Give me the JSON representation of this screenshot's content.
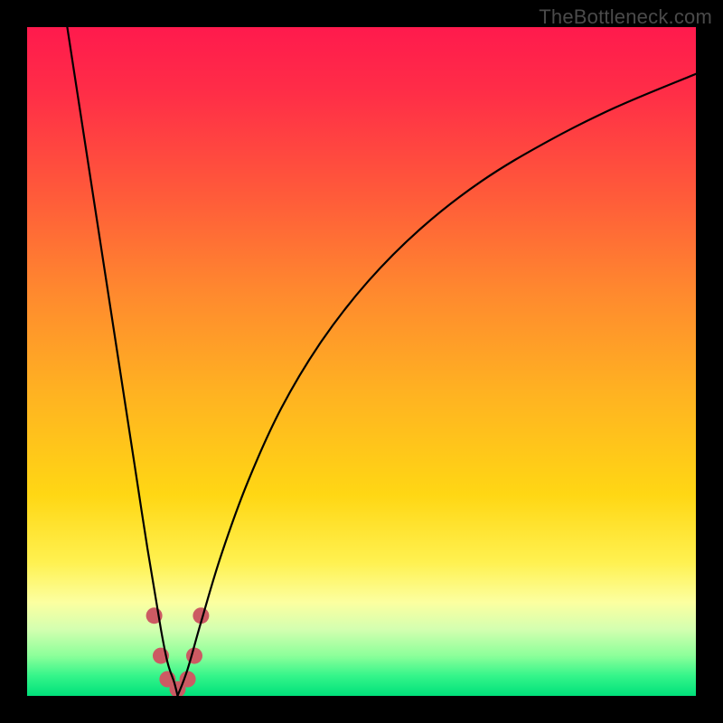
{
  "watermark": "TheBottleneck.com",
  "gradient_stops": [
    {
      "offset": 0.0,
      "color": "#ff1a4d"
    },
    {
      "offset": 0.1,
      "color": "#ff2e47"
    },
    {
      "offset": 0.25,
      "color": "#ff5a3a"
    },
    {
      "offset": 0.4,
      "color": "#ff8a2e"
    },
    {
      "offset": 0.55,
      "color": "#ffb321"
    },
    {
      "offset": 0.7,
      "color": "#ffd714"
    },
    {
      "offset": 0.8,
      "color": "#fff150"
    },
    {
      "offset": 0.86,
      "color": "#fcffa0"
    },
    {
      "offset": 0.9,
      "color": "#d4ffb0"
    },
    {
      "offset": 0.94,
      "color": "#8cff9a"
    },
    {
      "offset": 0.97,
      "color": "#35f58a"
    },
    {
      "offset": 1.0,
      "color": "#00e07a"
    }
  ],
  "markers": {
    "color": "#cc5a63",
    "radius": 9,
    "points": [
      {
        "x": 0.19,
        "y": 0.12
      },
      {
        "x": 0.2,
        "y": 0.06
      },
      {
        "x": 0.21,
        "y": 0.025
      },
      {
        "x": 0.225,
        "y": 0.01
      },
      {
        "x": 0.24,
        "y": 0.025
      },
      {
        "x": 0.25,
        "y": 0.06
      },
      {
        "x": 0.26,
        "y": 0.12
      }
    ]
  },
  "chart_data": {
    "type": "line",
    "title": "",
    "xlabel": "",
    "ylabel": "",
    "xlim": [
      0,
      1
    ],
    "ylim": [
      0,
      1
    ],
    "grid": false,
    "legend": false,
    "series": [
      {
        "name": "curve-left",
        "x": [
          0.06,
          0.08,
          0.1,
          0.12,
          0.14,
          0.16,
          0.18,
          0.2,
          0.21,
          0.22,
          0.225
        ],
        "values": [
          1.0,
          0.87,
          0.74,
          0.61,
          0.48,
          0.35,
          0.22,
          0.1,
          0.05,
          0.02,
          0.0
        ]
      },
      {
        "name": "curve-right",
        "x": [
          0.225,
          0.24,
          0.26,
          0.29,
          0.33,
          0.38,
          0.44,
          0.51,
          0.59,
          0.68,
          0.78,
          0.88,
          1.0
        ],
        "values": [
          0.0,
          0.04,
          0.11,
          0.21,
          0.32,
          0.43,
          0.53,
          0.62,
          0.7,
          0.77,
          0.83,
          0.88,
          0.93
        ]
      }
    ],
    "min_marker": {
      "x": 0.225,
      "y": 0.0
    }
  }
}
